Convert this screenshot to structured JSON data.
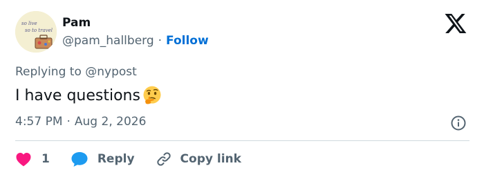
{
  "author": {
    "display_name": "Pam",
    "handle": "@pam_hallberg",
    "separator": "·",
    "follow_label": "Follow",
    "avatar_text": [
      "so live",
      "so to travel"
    ]
  },
  "brand": {
    "logo": "x-logo-icon"
  },
  "tweet": {
    "replying_to": "Replying to @nypost",
    "text": "I have questions",
    "emoji": "thinking-face-emoji",
    "time": "4:57 PM",
    "date_separator": "·",
    "date": "Aug 2, 2026"
  },
  "actions": {
    "like_count": "1",
    "reply_label": "Reply",
    "copy_label": "Copy link"
  },
  "colors": {
    "text_primary": "#0f1419",
    "text_secondary": "#536471",
    "link_blue": "#006fd6",
    "like_red": "#f91880",
    "reply_blue": "#1d9bf0",
    "divider": "#cfd9de"
  }
}
